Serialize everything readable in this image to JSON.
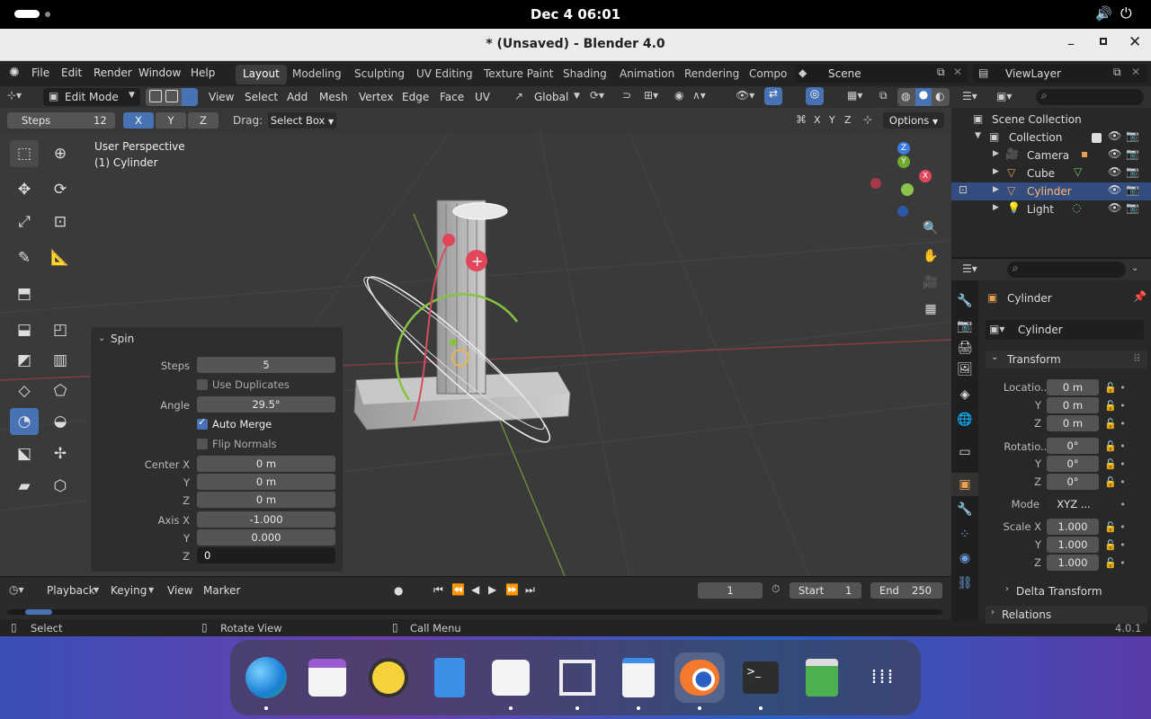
{
  "system": {
    "date_time": "Dec 4  06:01"
  },
  "window": {
    "title": "* (Unsaved) - Blender 4.0"
  },
  "menu": {
    "items": [
      "File",
      "Edit",
      "Render",
      "Window",
      "Help"
    ],
    "tabs": [
      "Layout",
      "Modeling",
      "Sculpting",
      "UV Editing",
      "Texture Paint",
      "Shading",
      "Animation",
      "Rendering",
      "Compo"
    ],
    "scene": "Scene",
    "view_layer": "ViewLayer"
  },
  "header": {
    "mode": "Edit Mode",
    "menus": [
      "View",
      "Select",
      "Add",
      "Mesh",
      "Vertex",
      "Edge",
      "Face",
      "UV"
    ],
    "orientation": "Global"
  },
  "toolsettings": {
    "steps_label": "Steps",
    "steps_value": "12",
    "axes": [
      "X",
      "Y",
      "Z"
    ],
    "drag_label": "Drag:",
    "drag_value": "Select Box",
    "options": "Options"
  },
  "viewport": {
    "perspective": "User Perspective",
    "object": "(1) Cylinder"
  },
  "spin_panel": {
    "title": "Spin",
    "steps_label": "Steps",
    "steps": "5",
    "use_duplicates": "Use Duplicates",
    "angle_label": "Angle",
    "angle": "29.5°",
    "auto_merge": "Auto Merge",
    "flip_normals": "Flip Normals",
    "center_x_label": "Center X",
    "center_x": "0 m",
    "center_y_label": "Y",
    "center_y": "0 m",
    "center_z_label": "Z",
    "center_z": "0 m",
    "axis_x_label": "Axis X",
    "axis_x": "-1.000",
    "axis_y_label": "Y",
    "axis_y": "0.000",
    "axis_z_label": "Z",
    "axis_z": "0"
  },
  "timeline": {
    "menus": [
      "Playback",
      "Keying",
      "View",
      "Marker"
    ],
    "current_frame": "1",
    "start_label": "Start",
    "start": "1",
    "end_label": "End",
    "end": "250"
  },
  "status": {
    "select": "Select",
    "rotate": "Rotate View",
    "call_menu": "Call Menu",
    "version": "4.0.1"
  },
  "outliner": {
    "scene_collection": "Scene Collection",
    "collection": "Collection",
    "objects": [
      "Camera",
      "Cube",
      "Cylinder",
      "Light"
    ]
  },
  "properties": {
    "object_name": "Cylinder",
    "data_name": "Cylinder",
    "transform": "Transform",
    "location_label": "Locatio...",
    "location": [
      "0 m",
      "0 m",
      "0 m"
    ],
    "rotation_label": "Rotatio...",
    "rotation": [
      "0°",
      "0°",
      "0°"
    ],
    "mode_label": "Mode",
    "mode": "XYZ ...",
    "scale_label": "Scale X",
    "scale": [
      "1.000",
      "1.000",
      "1.000"
    ],
    "axis_y": "Y",
    "axis_z": "Z",
    "delta_transform": "Delta Transform",
    "relations": "Relations"
  },
  "colors": {
    "accent": "#4772b3",
    "selected_row": "#334d80",
    "x_axis": "#e0475b",
    "y_axis": "#8bc34a",
    "z_axis": "#3d7be0"
  }
}
